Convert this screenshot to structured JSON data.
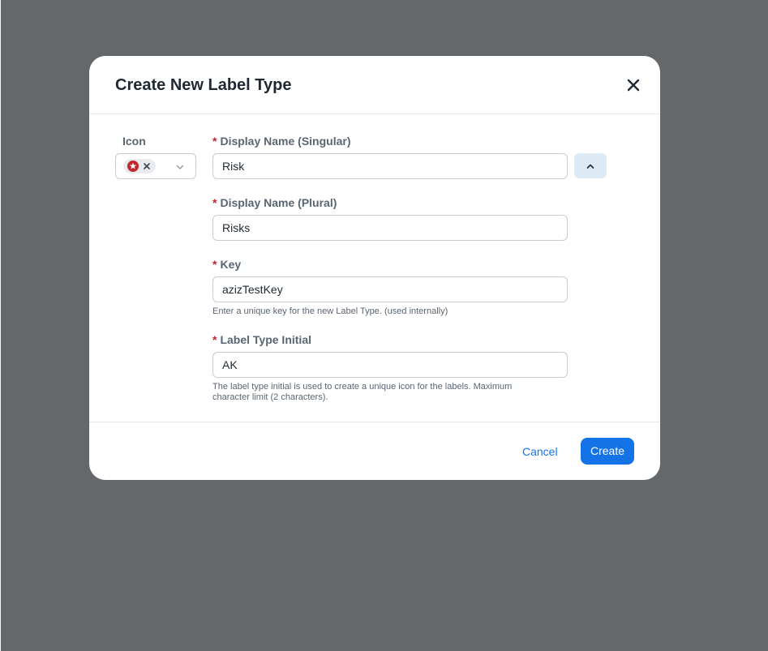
{
  "dialog": {
    "title": "Create New Label Type"
  },
  "icon_field": {
    "label": "Icon",
    "selected_icon": "red-star-badge-icon",
    "selected_icon_color": "#c0282e"
  },
  "display_name_singular": {
    "label": "Display Name (Singular)",
    "required_marker": "*",
    "value": "Risk"
  },
  "display_name_plural": {
    "label": "Display Name (Plural)",
    "required_marker": "*",
    "value": "Risks"
  },
  "key": {
    "label": "Key",
    "required_marker": "*",
    "value": "azizTestKey",
    "help": "Enter a unique key for the new Label Type. (used internally)"
  },
  "label_type_initial": {
    "label": "Label Type Initial",
    "required_marker": "*",
    "value": "AK",
    "help_line1": "The label type initial is used to create a unique icon for the labels. Maximum",
    "help_line2": "character limit (2 characters)."
  },
  "footer": {
    "cancel_label": "Cancel",
    "create_label": "Create"
  },
  "colors": {
    "overlay": "#65686b",
    "primary": "#1473e6",
    "required": "#c0282e",
    "collapse_button_bg": "#dde9f3"
  }
}
